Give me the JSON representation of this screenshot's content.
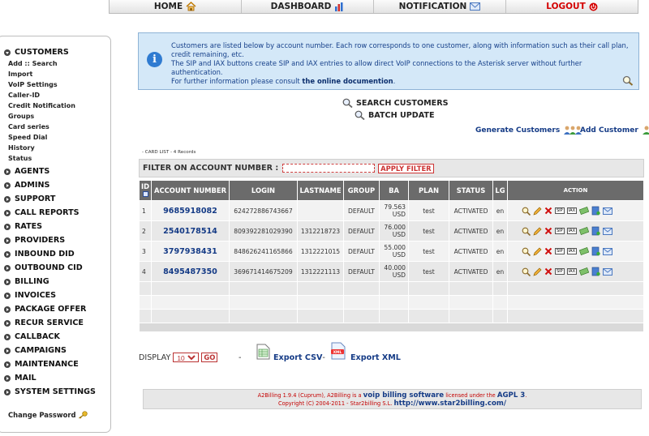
{
  "nav": {
    "home": "HOME",
    "dashboard": "DASHBOARD",
    "notification": "NOTIFICATION",
    "logout": "LOGOUT"
  },
  "sidebar": {
    "customers": "CUSTOMERS",
    "customer_items": [
      "Add :: Search",
      "Import",
      "VoIP Settings",
      "Caller-ID",
      "Credit Notification",
      "Groups",
      "Card series",
      "Speed Dial",
      "History",
      "Status"
    ],
    "sections": [
      "AGENTS",
      "ADMINS",
      "SUPPORT",
      "CALL REPORTS",
      "RATES",
      "PROVIDERS",
      "INBOUND DID",
      "OUTBOUND CID",
      "BILLING",
      "INVOICES",
      "PACKAGE OFFER",
      "RECUR SERVICE",
      "CALLBACK",
      "CAMPAIGNS",
      "MAINTENANCE",
      "MAIL",
      "SYSTEM SETTINGS"
    ],
    "change_password": "Change Password"
  },
  "info": {
    "line1": "Customers are listed below by account number. Each row corresponds to one customer, along with information such as their call plan, credit remaining, etc.",
    "line2": "The SIP and IAX buttons create SIP and IAX entries to allow direct VoIP connections to the Asterisk server without further authentication.",
    "line3_prefix": "For further information please consult ",
    "line3_link": "the online documention",
    "line3_suffix": "."
  },
  "actions": {
    "search": "SEARCH CUSTOMERS",
    "batch": "BATCH UPDATE",
    "generate": "Generate Customers",
    "add": "Add Customer"
  },
  "card_list": "- CARD LIST - 4 Records",
  "filter": {
    "label": "FILTER ON ACCOUNT NUMBER :",
    "apply": "APPLY FILTER"
  },
  "table": {
    "headers": [
      "ID",
      "ACCOUNT NUMBER",
      "LOGIN",
      "LASTNAME",
      "GROUP",
      "BA",
      "PLAN",
      "STATUS",
      "LG",
      "ACTION"
    ],
    "rows": [
      {
        "id": "1",
        "account": "9685918082",
        "login": "624272886743667",
        "lastname": "",
        "group": "DEFAULT",
        "ba": "79.563 USD",
        "plan": "test",
        "status": "ACTIVATED",
        "lg": "en"
      },
      {
        "id": "2",
        "account": "2540178514",
        "login": "809392281029390",
        "lastname": "1312218723",
        "group": "DEFAULT",
        "ba": "76.000 USD",
        "plan": "test",
        "status": "ACTIVATED",
        "lg": "en"
      },
      {
        "id": "3",
        "account": "3797938431",
        "login": "848626241165866",
        "lastname": "1312221015",
        "group": "DEFAULT",
        "ba": "55.000 USD",
        "plan": "test",
        "status": "ACTIVATED",
        "lg": "en"
      },
      {
        "id": "4",
        "account": "8495487350",
        "login": "369671414675209",
        "lastname": "1312221113",
        "group": "DEFAULT",
        "ba": "40.000 USD",
        "plan": "test",
        "status": "ACTIVATED",
        "lg": "en"
      }
    ],
    "sip": "SIP",
    "iax": "IAX"
  },
  "bottom": {
    "display": "DISPLAY",
    "display_value": "10",
    "go": "GO",
    "dash": "-",
    "export_csv": "Export CSV",
    "export_xml": "Export XML",
    "csv_dash": "-"
  },
  "footer": {
    "pre": "A2Billing 1.9.4 (Cuprum), A2Billing is a ",
    "link1": "voip billing software",
    "mid": " licensed under the ",
    "link2": "AGPL 3",
    "dot": ".",
    "line2": "Copyright (C) 2004-2011 - Star2billing S.L. ",
    "link3": "http://www.star2billing.com/"
  },
  "colors": {
    "header_bg": "#6b6b6b",
    "link": "#153b86",
    "info_bg": "#d4e8f8",
    "logout": "#d40000"
  }
}
